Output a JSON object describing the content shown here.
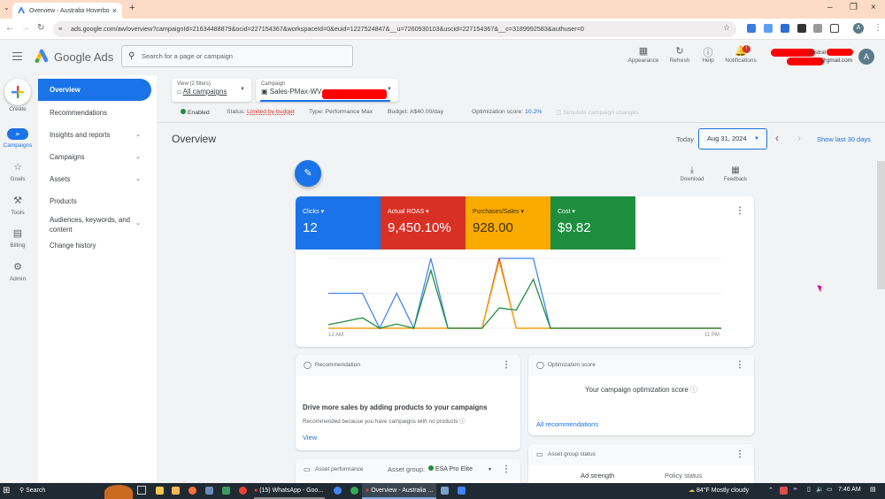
{
  "browser": {
    "tab_title": "Overview - Australia Hoverbo",
    "url": "ads.google.com/aw/overview?campaignId=21634488879&ocid=227154367&workspaceId=0&euid=1227524847&__u=7260930103&uscid=227154367&__c=3189992583&authuser=0",
    "profile_initial": "A"
  },
  "header": {
    "brand": "Google Ads",
    "search_placeholder": "Search for a page or campaign",
    "tools": [
      {
        "label": "Appearance",
        "icon": "appearance-icon"
      },
      {
        "label": "Refresh",
        "icon": "refresh-icon"
      },
      {
        "label": "Help",
        "icon": "help-icon"
      },
      {
        "label": "Notifications",
        "icon": "bell-icon",
        "badge": "!"
      }
    ],
    "account_name": "Austral",
    "account_email": "@gmail.com",
    "avatar_initial": "A"
  },
  "rail": [
    {
      "label": "Create",
      "icon": "plus-icon"
    },
    {
      "label": "Campaigns",
      "icon": "megaphone-icon",
      "active": true
    },
    {
      "label": "Goals",
      "icon": "trophy-icon"
    },
    {
      "label": "Tools",
      "icon": "tools-icon"
    },
    {
      "label": "Billing",
      "icon": "card-icon"
    },
    {
      "label": "Admin",
      "icon": "gear-icon"
    }
  ],
  "sidenav": [
    {
      "label": "Overview",
      "active": true
    },
    {
      "label": "Recommendations"
    },
    {
      "label": "Insights and reports",
      "expandable": true
    },
    {
      "label": "Campaigns",
      "expandable": true
    },
    {
      "label": "Assets",
      "expandable": true
    },
    {
      "label": "Products"
    },
    {
      "label": "Audiences, keywords, and content",
      "expandable": true
    },
    {
      "label": "Change history"
    }
  ],
  "filters": {
    "view_label": "View (2 filters)",
    "view_value": "All campaigns",
    "campaign_label": "Campaign",
    "campaign_value": "Sales-PMax-WV"
  },
  "status": {
    "enabled": "Enabled",
    "status_label": "Status:",
    "status_value": "Limited by budget",
    "type": "Type: Performance Max",
    "budget": "Budget: A$40.00/day",
    "opt_label": "Optimization score:",
    "opt_value": "10.2%",
    "simulate": "Simulate campaign changes"
  },
  "page": {
    "title": "Overview",
    "today_label": "Today",
    "date": "Aug 31, 2024",
    "show_last": "Show last 30 days",
    "download": "Download",
    "feedback": "Feedback"
  },
  "metrics": [
    {
      "label": "Clicks",
      "value": "12",
      "color": "#1a73e8"
    },
    {
      "label": "Actual ROAS",
      "value": "9,450.10%",
      "color": "#d93025"
    },
    {
      "label": "Purchases/Sales",
      "value": "928.00",
      "color": "#f9ab00"
    },
    {
      "label": "Cost",
      "value": "$9.82",
      "color": "#1e8e3e"
    }
  ],
  "chart_data": {
    "type": "line",
    "x_start_label": "12 AM",
    "x_end_label": "11 PM",
    "x": [
      0,
      1,
      2,
      3,
      4,
      5,
      6,
      7,
      8,
      9,
      10,
      11,
      12,
      13,
      14,
      15,
      16,
      17,
      18,
      19,
      20,
      21,
      22,
      23
    ],
    "ylim": [
      0,
      1
    ],
    "grid": true,
    "series": [
      {
        "name": "Clicks",
        "color": "#4285f4",
        "values": [
          0.5,
          0.5,
          0.5,
          0,
          0.5,
          0,
          1,
          0,
          0,
          0,
          1,
          1,
          1,
          0,
          0,
          0,
          0,
          0,
          0,
          0,
          0,
          0,
          0,
          0
        ]
      },
      {
        "name": "Actual ROAS",
        "color": "#d93025",
        "values": [
          0,
          0,
          0,
          0,
          0,
          0,
          0,
          0,
          0,
          0,
          1,
          0,
          0,
          0,
          0,
          0,
          0,
          0,
          0,
          0,
          0,
          0,
          0,
          0
        ]
      },
      {
        "name": "Purchases/Sales",
        "color": "#f9ab00",
        "values": [
          0,
          0,
          0,
          0,
          0,
          0,
          0,
          0,
          0,
          0,
          0.96,
          0,
          0,
          0,
          0,
          0,
          0,
          0,
          0,
          0,
          0,
          0,
          0,
          0
        ]
      },
      {
        "name": "Cost",
        "color": "#1e8e3e",
        "values": [
          0.05,
          0.1,
          0.15,
          0,
          0.06,
          0,
          0.83,
          0,
          0,
          0,
          0.29,
          0.26,
          0.7,
          0,
          0,
          0,
          0,
          0,
          0,
          0,
          0,
          0,
          0,
          0
        ]
      }
    ]
  },
  "cards": {
    "recommendation": {
      "title": "Recommendation",
      "headline": "Drive more sales by adding products to your campaigns",
      "reason": "Recommended because you have campaigns with no products",
      "link": "View"
    },
    "optimization": {
      "title": "Optimization score",
      "headline": "Your campaign optimization score",
      "link": "All recommendations"
    },
    "asset_performance": {
      "title": "Asset performance",
      "group_label": "Asset group:",
      "group_value": "ESA Pro Elite"
    },
    "asset_group_status": {
      "title": "Asset group status",
      "col1": "Ad strength",
      "col2": "Policy status"
    }
  },
  "taskbar": {
    "search": "Search",
    "whatsapp": "(15) WhatsApp - Goo...",
    "chrome_window": "Overview - Australia ...",
    "weather": "84°F  Mostly cloudy",
    "time": "7:46 AM"
  }
}
